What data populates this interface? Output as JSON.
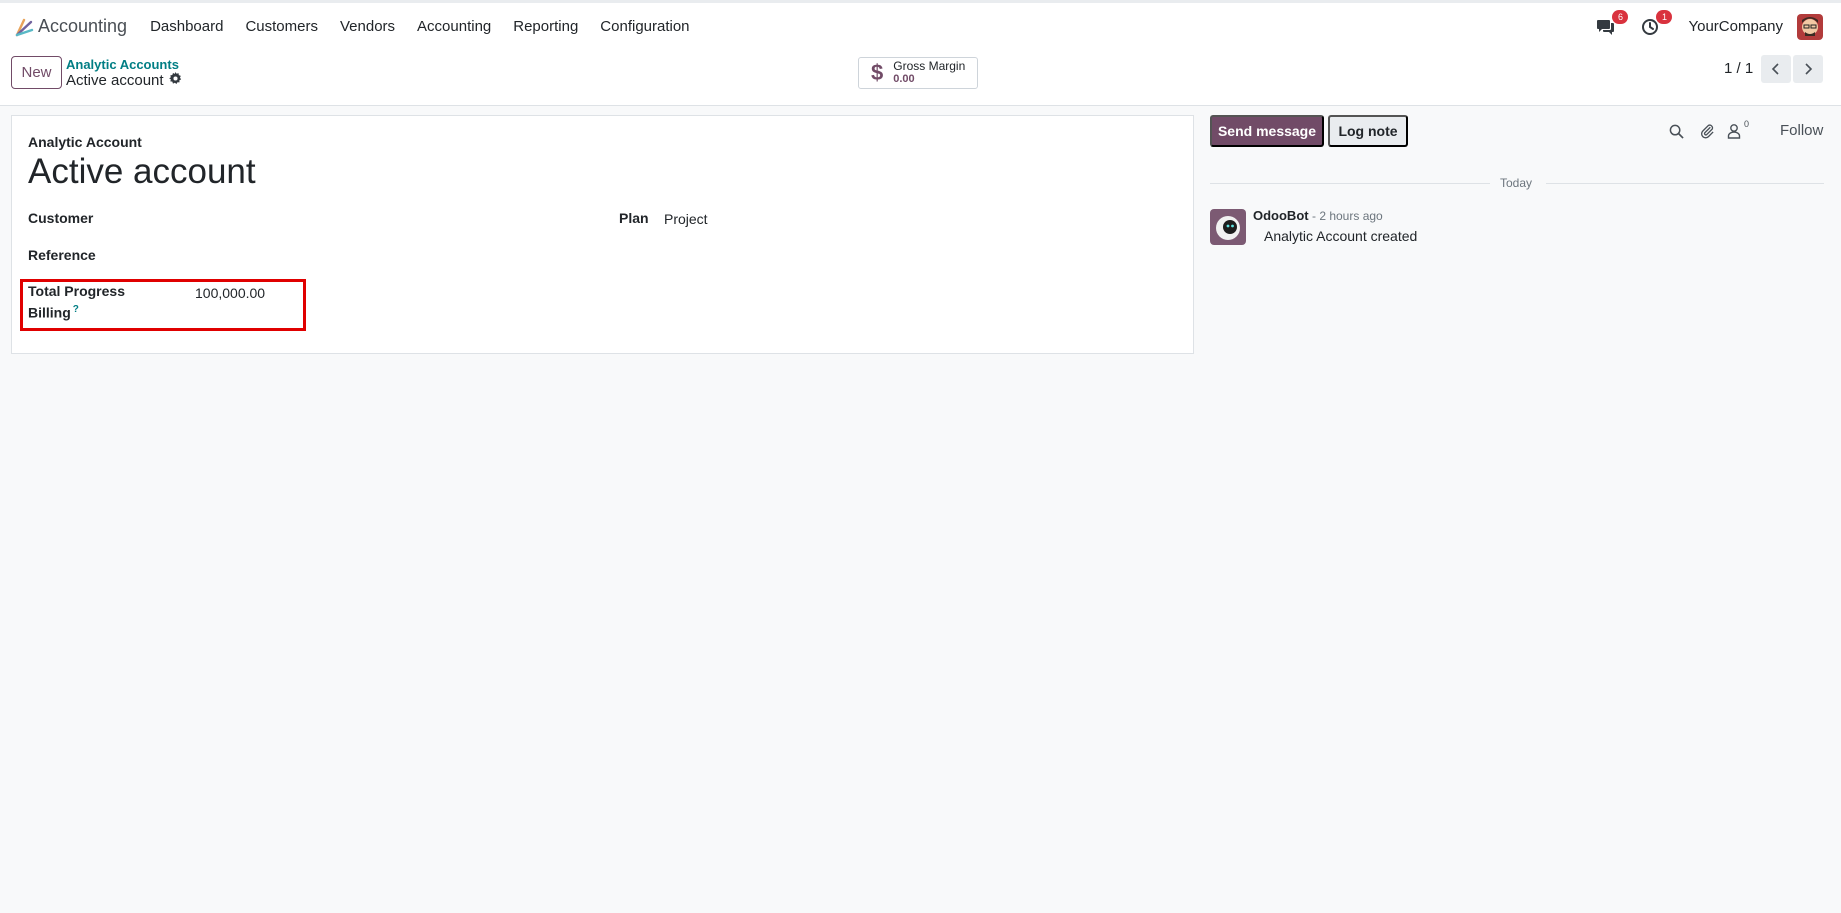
{
  "navbar": {
    "app_name": "Accounting",
    "menu": [
      "Dashboard",
      "Customers",
      "Vendors",
      "Accounting",
      "Reporting",
      "Configuration"
    ],
    "messages_badge": "6",
    "activities_badge": "1",
    "company": "YourCompany"
  },
  "control_panel": {
    "new_label": "New",
    "breadcrumb_parent": "Analytic Accounts",
    "breadcrumb_current": "Active account",
    "stat_button": {
      "label": "Gross Margin",
      "value": "0.00"
    },
    "pager": "1 / 1"
  },
  "form": {
    "caption": "Analytic Account",
    "title": "Active account",
    "customer_label": "Customer",
    "customer_value": "",
    "reference_label": "Reference",
    "reference_value": "",
    "plan_label": "Plan",
    "plan_value": "Project",
    "progress_label_line1": "Total Progress",
    "progress_label_line2": "Billing",
    "progress_help": "?",
    "progress_value": "100,000.00"
  },
  "chatter": {
    "send_label": "Send message",
    "log_label": "Log note",
    "followers_count": "0",
    "follow_label": "Follow",
    "date_separator": "Today",
    "message": {
      "author": "OdooBot",
      "time": "- 2 hours ago",
      "body": "Analytic Account created"
    }
  },
  "colors": {
    "primary": "#714b67",
    "link": "#017e84",
    "badge": "#d9323e",
    "highlight": "#e00000"
  }
}
